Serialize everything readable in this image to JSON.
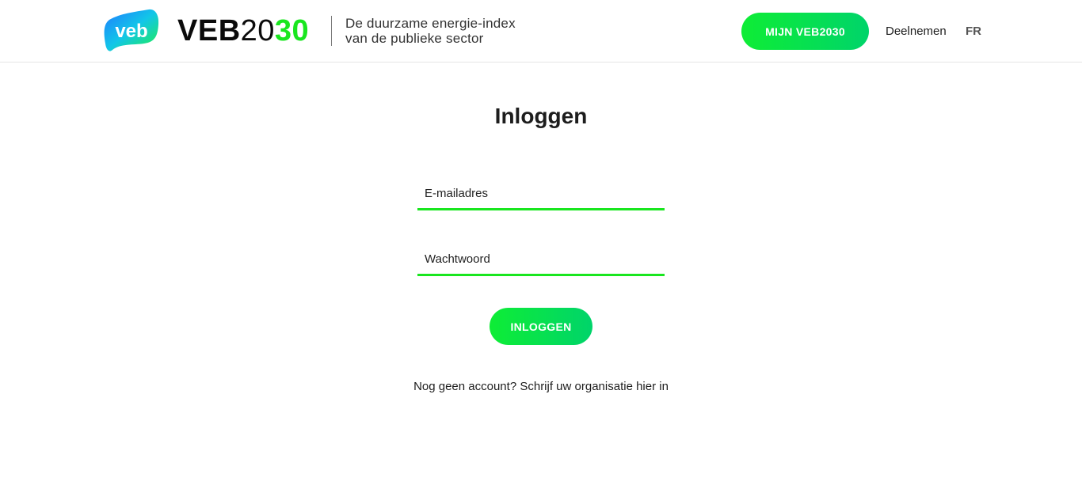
{
  "header": {
    "logo_text": "veb",
    "brand": {
      "part1": "VEB",
      "part2": "20",
      "part3": "30"
    },
    "tagline_line1": "De duurzame energie-index",
    "tagline_line2": "van de publieke sector",
    "mijn_button_label": "MIJN VEB2030",
    "nav_deelnemen": "Deelnemen",
    "nav_language": "FR"
  },
  "main": {
    "title": "Inloggen",
    "email_placeholder": "E-mailadres",
    "password_placeholder": "Wachtwoord",
    "login_button_label": "INLOGGEN",
    "signup_prefix": "Nog geen account? ",
    "signup_link": "Schrijf uw organisatie hier in"
  },
  "colors": {
    "accent_green": "#19e61f",
    "button_gradient_start": "#0eed35",
    "button_gradient_end": "#00d46a",
    "logo_blue": "#1f7bff"
  }
}
